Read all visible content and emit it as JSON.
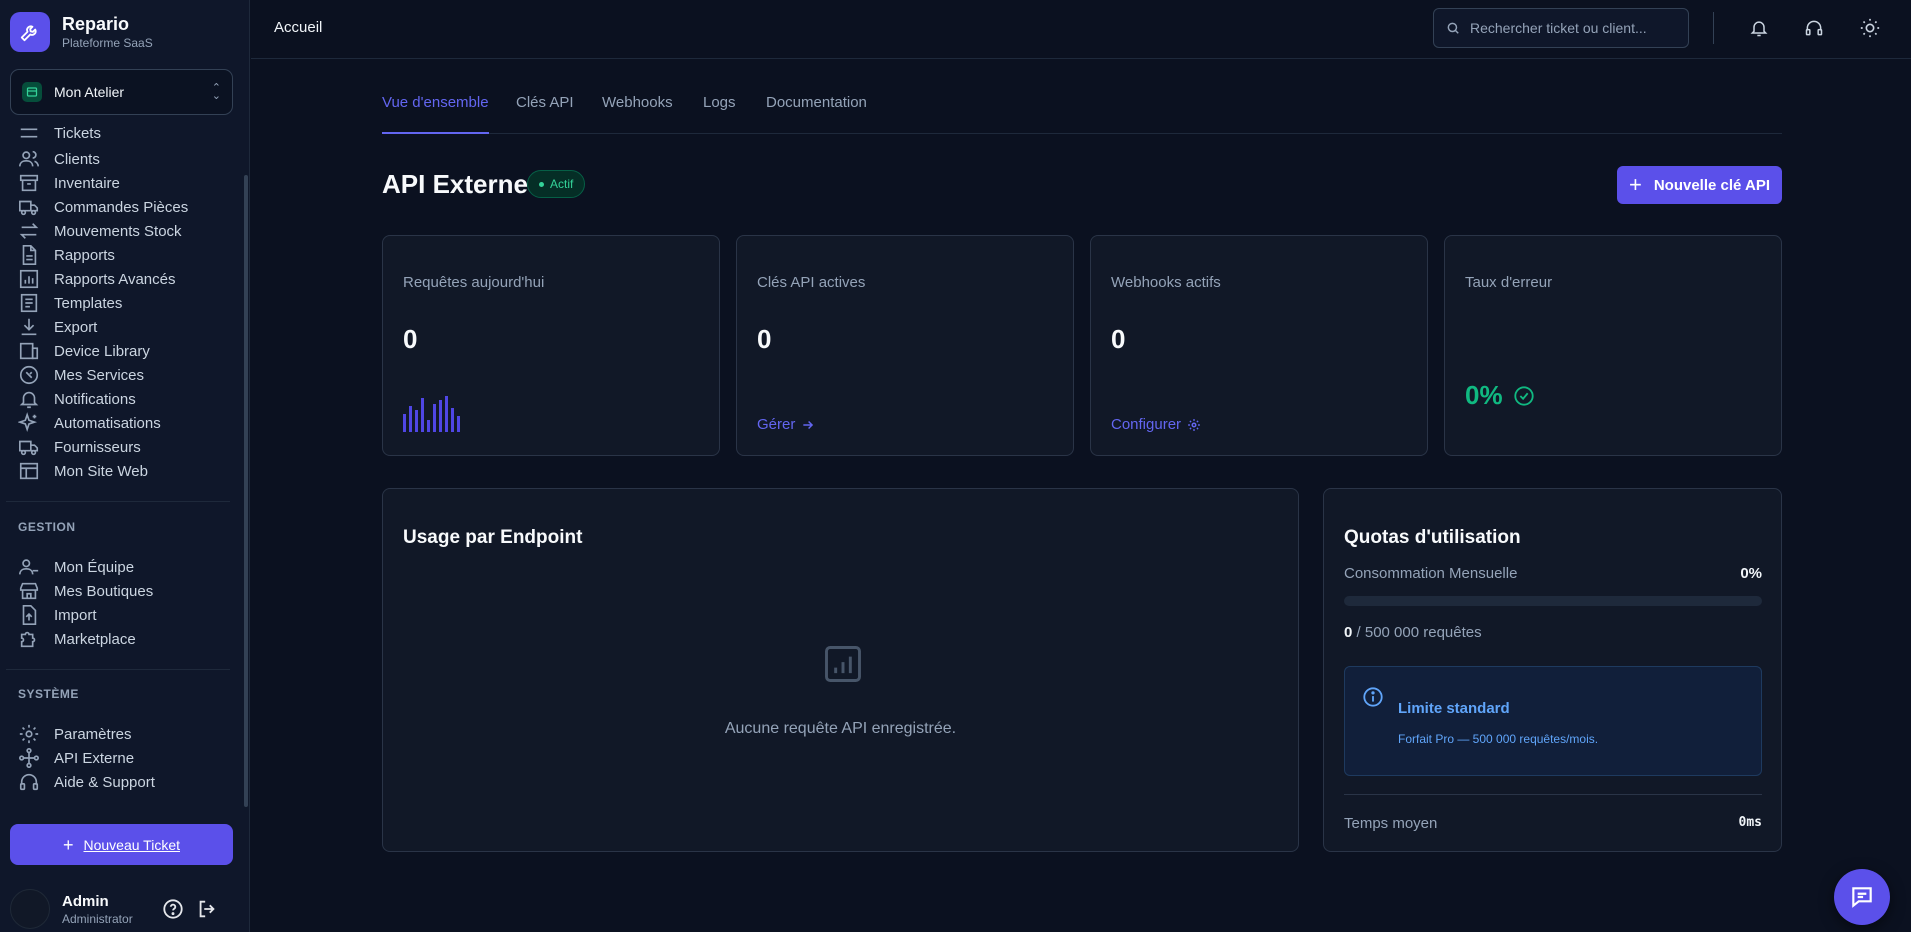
{
  "brand": {
    "name": "Repario",
    "subtitle": "Plateforme SaaS"
  },
  "workspace": {
    "label": "Mon Atelier"
  },
  "sidebar": {
    "items": [
      {
        "label": "Tickets",
        "icon": "ticket-icon"
      },
      {
        "label": "Clients",
        "icon": "users-icon"
      },
      {
        "label": "Inventaire",
        "icon": "archive-icon"
      },
      {
        "label": "Commandes Pièces",
        "icon": "truck-icon"
      },
      {
        "label": "Mouvements Stock",
        "icon": "arrows-icon"
      },
      {
        "label": "Rapports",
        "icon": "file-icon"
      },
      {
        "label": "Rapports Avancés",
        "icon": "chart-icon"
      },
      {
        "label": "Templates",
        "icon": "template-icon"
      },
      {
        "label": "Export",
        "icon": "download-icon"
      },
      {
        "label": "Device Library",
        "icon": "devices-icon"
      },
      {
        "label": "Mes Services",
        "icon": "wrench-icon"
      },
      {
        "label": "Notifications",
        "icon": "bell-icon"
      },
      {
        "label": "Automatisations",
        "icon": "sparkles-icon"
      },
      {
        "label": "Fournisseurs",
        "icon": "truck-icon"
      },
      {
        "label": "Mon Site Web",
        "icon": "browser-icon"
      }
    ],
    "gestion_title": "GESTION",
    "gestion": [
      {
        "label": "Mon Équipe",
        "icon": "team-icon"
      },
      {
        "label": "Mes Boutiques",
        "icon": "store-icon"
      },
      {
        "label": "Import",
        "icon": "upload-icon"
      },
      {
        "label": "Marketplace",
        "icon": "puzzle-icon"
      }
    ],
    "systeme_title": "SYSTÈME",
    "systeme": [
      {
        "label": "Paramètres",
        "icon": "gear-icon"
      },
      {
        "label": "API Externe",
        "icon": "api-icon"
      },
      {
        "label": "Aide & Support",
        "icon": "headset-icon"
      }
    ],
    "new_ticket": "Nouveau Ticket"
  },
  "user": {
    "name": "Admin",
    "role": "Administrator"
  },
  "topbar": {
    "breadcrumb": "Accueil",
    "search_placeholder": "Rechercher ticket ou client..."
  },
  "tabs": [
    "Vue d'ensemble",
    "Clés API",
    "Webhooks",
    "Logs",
    "Documentation"
  ],
  "page": {
    "title": "API Externe",
    "badge": "Actif",
    "primary_button": "Nouvelle clé API"
  },
  "stats": [
    {
      "label": "Requêtes aujourd'hui",
      "value": "0"
    },
    {
      "label": "Clés API actives",
      "value": "0",
      "link": "Gérer"
    },
    {
      "label": "Webhooks actifs",
      "value": "0",
      "link": "Configurer"
    },
    {
      "label": "Taux d'erreur",
      "value": "0%"
    }
  ],
  "usage": {
    "title": "Usage par Endpoint",
    "empty": "Aucune requête API enregistrée."
  },
  "quotas": {
    "title": "Quotas d'utilisation",
    "monthly_label": "Consommation Mensuelle",
    "monthly_value": "0%",
    "monthly_fraction": 0,
    "count_used": "0",
    "count_rest": " / 500 000 requêtes",
    "info_title": "Limite standard",
    "info_sub": "Forfait Pro — 500 000 requêtes/mois.",
    "avg_label": "Temps moyen",
    "avg_value": "0ms"
  },
  "colors": {
    "accent": "#5b50ea",
    "link": "#6366f1",
    "success": "#10b981",
    "info": "#60a5fa"
  }
}
